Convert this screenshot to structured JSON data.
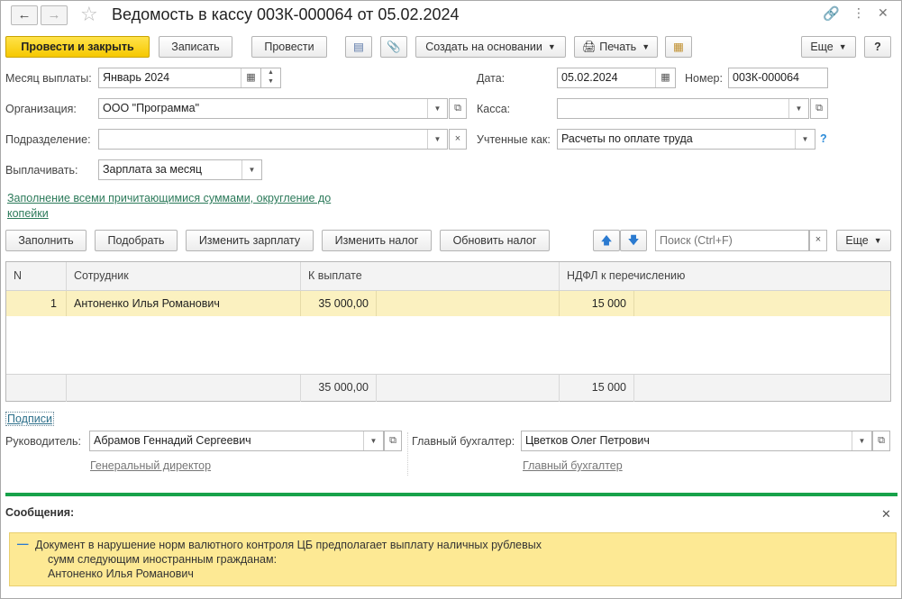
{
  "window": {
    "title": "Ведомость в кассу 003К-000064 от 05.02.2024"
  },
  "toolbar": {
    "post_close": "Провести и закрыть",
    "save": "Записать",
    "post": "Провести",
    "create_based": "Создать на основании",
    "print": "Печать",
    "more": "Еще",
    "help": "?"
  },
  "form": {
    "payment_month_label": "Месяц выплаты:",
    "payment_month": "Январь 2024",
    "date_label": "Дата:",
    "date": "05.02.2024",
    "number_label": "Номер:",
    "number": "003К-000064",
    "organization_label": "Организация:",
    "organization": "ООО \"Программа\"",
    "cashbox_label": "Касса:",
    "cashbox": "",
    "department_label": "Подразделение:",
    "department": "",
    "accounted_as_label": "Учтенные как:",
    "accounted_as": "Расчеты по оплате труда",
    "pay_label": "Выплачивать:",
    "pay": "Зарплата за месяц",
    "fill_link": "Заполнение всеми причитающимися суммами, округление до",
    "fill_link_2": "копейки"
  },
  "table_toolbar": {
    "fill": "Заполнить",
    "pick": "Подобрать",
    "change_salary": "Изменить зарплату",
    "change_tax": "Изменить налог",
    "update_tax": "Обновить налог",
    "search_placeholder": "Поиск (Ctrl+F)",
    "more": "Еще"
  },
  "table": {
    "columns": [
      "N",
      "Сотрудник",
      "К выплате",
      "НДФЛ к перечислению"
    ],
    "rows": [
      {
        "n": "1",
        "employee": "Антоненко Илья Романович",
        "amount": "35 000,00",
        "tax": "15 000"
      }
    ],
    "totals": {
      "amount": "35 000,00",
      "tax": "15 000"
    }
  },
  "signatures": {
    "link": "Подписи",
    "head_label": "Руководитель:",
    "head": "Абрамов Геннадий Сергеевич",
    "head_position": "Генеральный директор",
    "accountant_label": "Главный бухгалтер:",
    "accountant": "Цветков Олег Петрович",
    "accountant_position": "Главный бухгалтер"
  },
  "messages": {
    "title": "Сообщения:",
    "line1": "Документ в нарушение норм валютного контроля ЦБ предполагает выплату наличных рублевых",
    "line2": "сумм следующим иностранным гражданам:",
    "line3": "Антоненко Илья Романович"
  },
  "colors": {
    "primary_button": "#f6c800",
    "link": "#2c7a5a",
    "selected_row": "#fbf1c0",
    "separator": "#17a24a",
    "message_bg": "#fde994"
  }
}
